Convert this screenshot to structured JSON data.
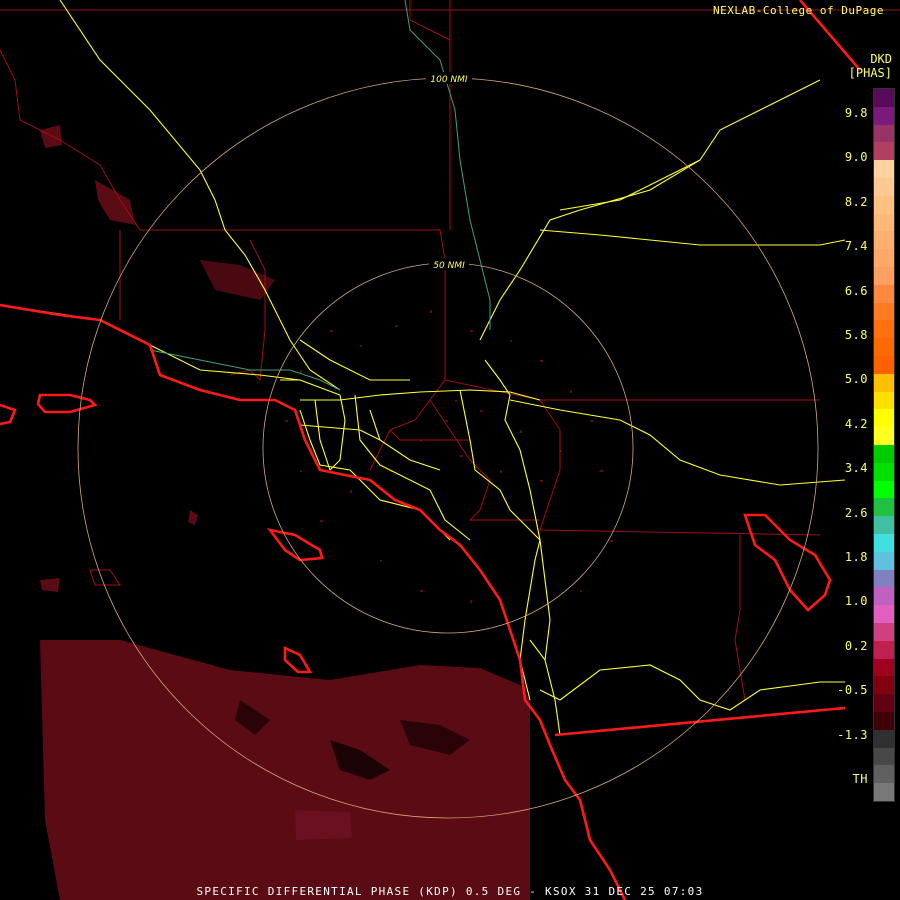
{
  "credit": "NEXLAB-College of DuPage",
  "product": {
    "code": "DKD",
    "unit": "[PHAS]"
  },
  "rings": [
    {
      "label": "100 NMI"
    },
    {
      "label": "50 NMI"
    }
  ],
  "legend": {
    "ticks": [
      "9.8",
      "9.0",
      "8.2",
      "7.4",
      "6.6",
      "5.8",
      "5.0",
      "4.2",
      "3.4",
      "2.6",
      "1.8",
      "1.0",
      "0.2",
      "-0.5",
      "-1.3",
      "TH"
    ],
    "colors": [
      "#5a0a5a",
      "#7a1a7a",
      "#993366",
      "#b04060",
      "#ffd0a0",
      "#ffc890",
      "#ffc080",
      "#ffb878",
      "#ffb070",
      "#ffa868",
      "#ffa060",
      "#ff8840",
      "#ff7a20",
      "#ff7010",
      "#ff6a00",
      "#ff6000",
      "#ffc000",
      "#ffe000",
      "#ffff00",
      "#ffff20",
      "#00cc00",
      "#00e000",
      "#00ff00",
      "#20c040",
      "#40c0a0",
      "#40e0e0",
      "#60c0e0",
      "#8080c0",
      "#c060c0",
      "#e060c0",
      "#d04080",
      "#c02050",
      "#a00020",
      "#800010",
      "#600010",
      "#400008",
      "#303030",
      "#484848",
      "#606060",
      "#787878"
    ]
  },
  "footer": "SPECIFIC DIFFERENTIAL PHASE (KDP) 0.5 DEG - KSOX 31 DEC 25 07:03"
}
